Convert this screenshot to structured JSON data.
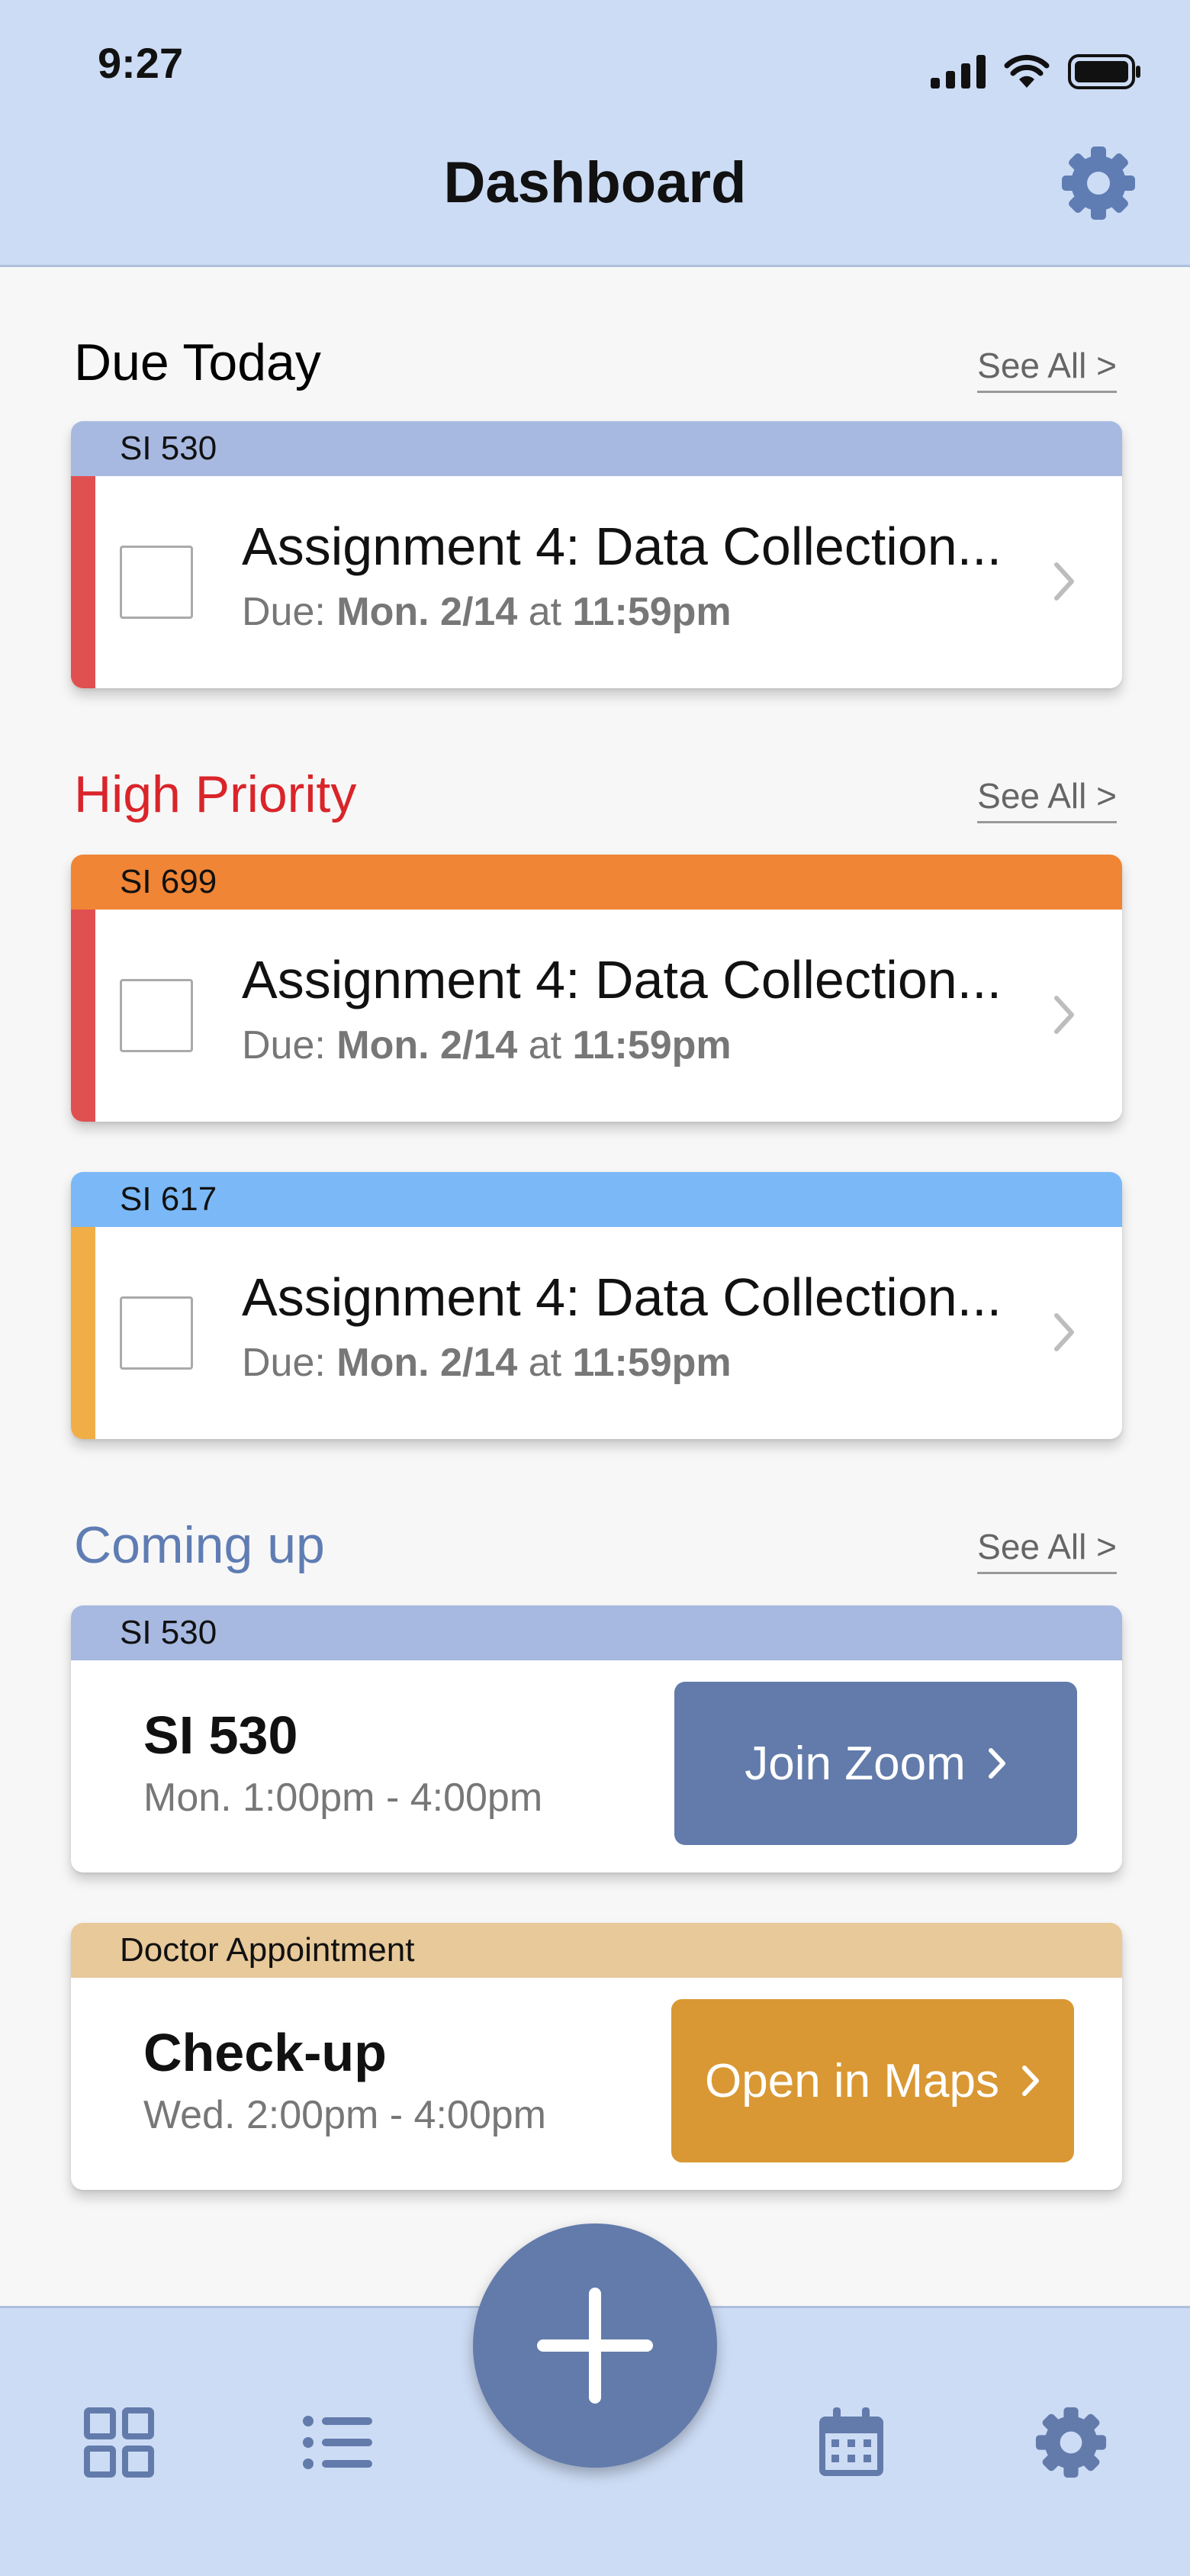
{
  "status_bar": {
    "time": "9:27"
  },
  "header": {
    "title": "Dashboard"
  },
  "sections": {
    "due_today": {
      "title": "Due Today",
      "see_all": "See All >",
      "title_color": "#111111",
      "cards": [
        {
          "course": "SI 530",
          "tag_color": "#a7b9e1",
          "stripe_color": "#e05050",
          "title": "Assignment 4: Data Collection...",
          "due_label": "Due:",
          "due_day": "Mon. 2/14",
          "due_at": "at",
          "due_time": "11:59pm"
        }
      ]
    },
    "high_priority": {
      "title": "High Priority",
      "see_all": "See All >",
      "title_color": "#d9252a",
      "cards": [
        {
          "course": "SI 699",
          "tag_color": "#ef8535",
          "stripe_color": "#e05050",
          "title": "Assignment 4: Data Collection...",
          "due_label": "Due:",
          "due_day": "Mon. 2/14",
          "due_at": "at",
          "due_time": "11:59pm"
        },
        {
          "course": "SI 617",
          "tag_color": "#7bb8f7",
          "stripe_color": "#f1ae47",
          "title": "Assignment 4: Data Collection...",
          "due_label": "Due:",
          "due_day": "Mon. 2/14",
          "due_at": "at",
          "due_time": "11:59pm"
        }
      ]
    },
    "coming_up": {
      "title": "Coming up",
      "see_all": "See All >",
      "title_color": "#5f7db3",
      "events": [
        {
          "tag": "SI 530",
          "tag_color": "#a7b9e1",
          "title": "SI 530",
          "time": "Mon. 1:00pm - 4:00pm",
          "button": "Join Zoom",
          "button_color": "#627bab"
        },
        {
          "tag": "Doctor Appointment",
          "tag_color": "#e8c99a",
          "title": "Check-up",
          "time": "Wed. 2:00pm - 4:00pm",
          "button": "Open in Maps",
          "button_color": "#d99834"
        }
      ]
    }
  },
  "tab_bar": {
    "icons": [
      "grid-icon",
      "list-icon",
      "plus-icon",
      "calendar-icon",
      "gear-icon"
    ],
    "accent": "#627bab"
  }
}
